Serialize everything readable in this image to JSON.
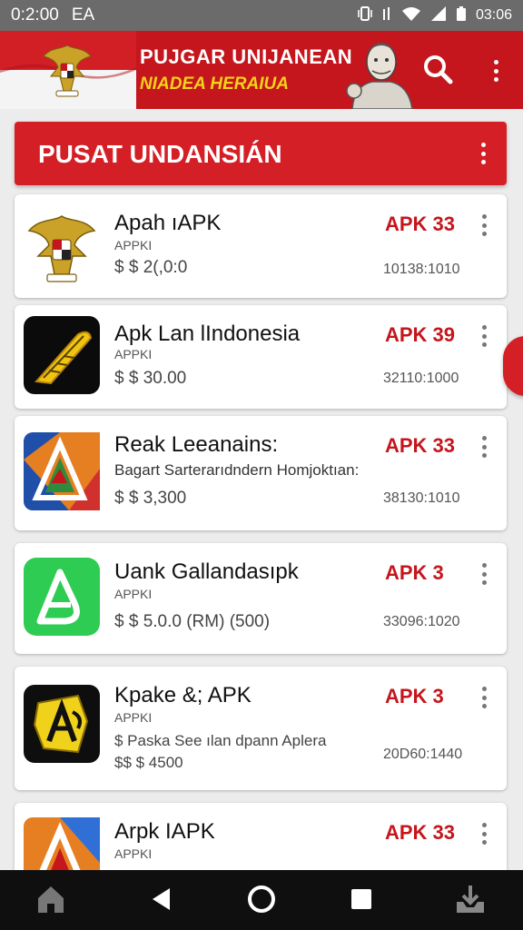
{
  "status_bar": {
    "time": "0:2:00",
    "left_label": "EA",
    "battery_text": "03:06",
    "icons": [
      "vibrate-icon",
      "signal-icon",
      "wifi-icon",
      "cellular-icon",
      "battery-icon"
    ]
  },
  "header": {
    "title_line1": "PUJGAR UNIJANEAN",
    "title_line2": "NIADEA HERAIUA",
    "search_icon": "search-icon",
    "menu_icon": "overflow-menu-icon",
    "colors": {
      "primary": "#c4161c",
      "accent": "#f5d21b"
    }
  },
  "section": {
    "title": "PUSAT UNDANSIÁN",
    "menu_icon": "overflow-menu-icon"
  },
  "apps": [
    {
      "name": "Apah ıAPK",
      "sub": "APPKI",
      "price": "$ $ 2(,0:0",
      "badge": "APK 33",
      "meta": "10138:1010",
      "icon": "garuda-emblem-icon"
    },
    {
      "name": "Apk Lan lIndonesia",
      "sub": "APPKI",
      "price": "$ $ 30.00",
      "badge": "APK 39",
      "meta": "32110:1000",
      "icon": "feather-pen-icon"
    },
    {
      "name": "Reak Leeanains:",
      "sub": "Bagart Sarterarıdndern Homjoktıan:",
      "price": "$ $ 3,300",
      "badge": "APK 33",
      "meta": "38130:1010",
      "icon": "map-triangle-icon"
    },
    {
      "name": "Uank Gallandasıpk",
      "sub": "APPKI",
      "price": "$ $ 5.0.0 (RM) (500)",
      "badge": "APK 3",
      "meta": "33096:1020",
      "icon": "green-a-icon"
    },
    {
      "name": "Kpake &; APK",
      "sub": "APPKI",
      "sub2": "$ Paska  See ılan dpann Aplera",
      "price": "$$ $ 4500",
      "badge": "APK 3",
      "meta": "20D60:1440",
      "icon": "yellow-emblem-icon"
    },
    {
      "name": "Arpk IAPK",
      "sub": "APPKI",
      "badge": "APK 33",
      "icon": "colorful-a-icon"
    }
  ],
  "nav": {
    "icons": [
      "home-icon",
      "back-icon",
      "home-circle-icon",
      "recents-icon",
      "download-icon"
    ]
  }
}
